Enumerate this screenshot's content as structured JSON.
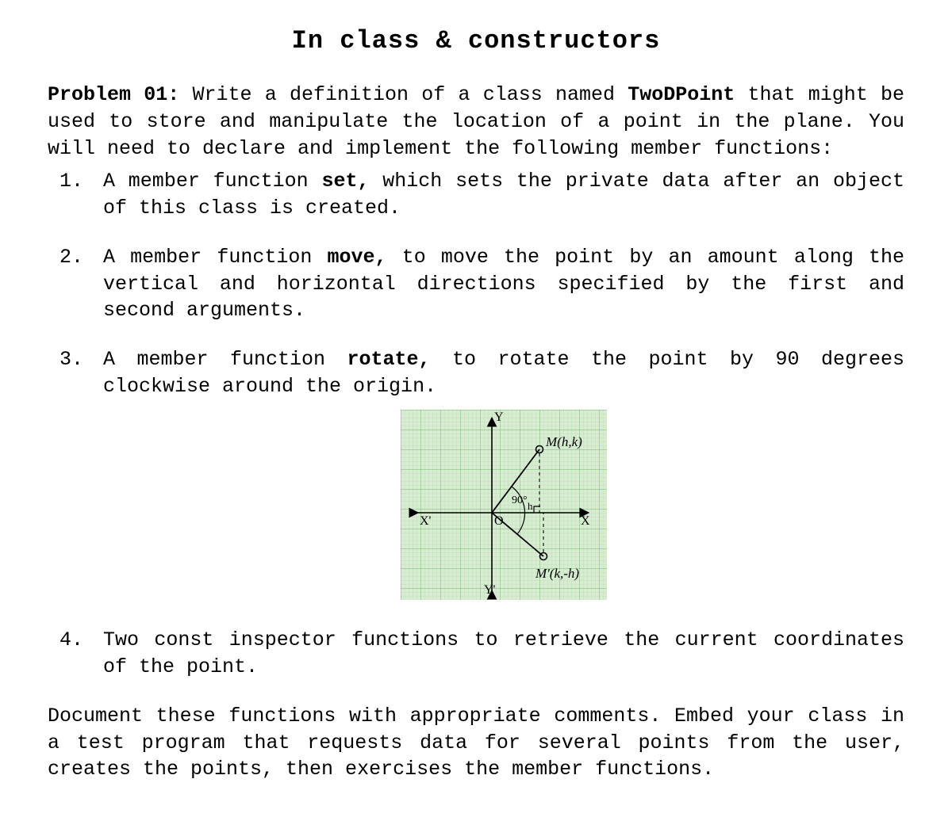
{
  "title": "In class & constructors",
  "intro_label": "Problem 01:",
  "intro_text_1": " Write a definition of a class named ",
  "class_name": "TwoDPoint",
  "intro_text_2": " that might be used to store and manipulate the location of a point in the plane. You will need to declare and implement the following member functions:",
  "items": {
    "1a": "A member function ",
    "1f": "set,",
    "1b": " which sets the private data after an object of this class is created.",
    "2a": "A member function ",
    "2f": "move,",
    "2b": " to move the point by an amount along the vertical and horizontal directions specified by the first and second arguments.",
    "3a": "A member function ",
    "3f": "rotate,",
    "3b": " to rotate the point by 90 degrees clockwise around the origin.",
    "4": "Two const inspector functions to retrieve the current coordinates of the point."
  },
  "closing": "Document these functions with appropriate comments. Embed your class in a test program that requests data for several points from the user, creates the points, then exercises the member functions.",
  "chart_data": {
    "type": "diagram",
    "description": "Coordinate plane showing 90° clockwise rotation of point M(h,k) about origin to M'(k,-h)",
    "axes": {
      "xpos": "X",
      "xneg": "X'",
      "ypos": "Y",
      "yneg": "Y'"
    },
    "origin_label": "O",
    "angle_label": "90°",
    "points": [
      {
        "label": "M(h,k)",
        "x": "h",
        "y": "k"
      },
      {
        "label": "M'(k,-h)",
        "x": "k",
        "y": "-h"
      }
    ]
  }
}
